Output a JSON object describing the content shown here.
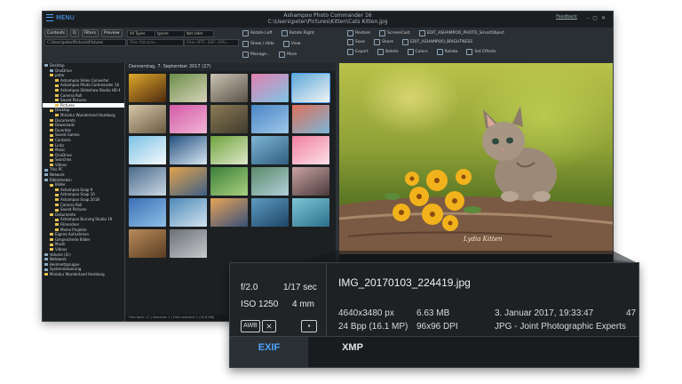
{
  "app": {
    "title": "Ashampoo Photo Commander 16",
    "path": "C:\\Users\\peter\\Pictures\\Kitten\\Cats Kitten.jpg",
    "menu_label": "MENU",
    "feedback_label": "Feedback"
  },
  "nav": {
    "buttons": [
      "Contexts",
      "Q",
      "Filters",
      "Preview"
    ],
    "path_value": "C:\\Users\\peter\\Pictures\\Pictures"
  },
  "toolbar": {
    "filter_type": "All Types",
    "filter_fav": "Ignore Favourites",
    "filter_rating": "Not older than...",
    "filter_name_placeholder": "Filter filename...",
    "filter_exif_placeholder": "Filter (IPTC, EXIF, GPS)...",
    "left_buttons": [
      "Rotate Left",
      "Rotate Right",
      "Show / Hide",
      "View",
      "Manage...",
      "More"
    ],
    "right_row1": [
      "Restore",
      "ScreenCast",
      "EDIT_ASHAMPOO_PHOTO_SmartObject"
    ],
    "right_row2": [
      "Save",
      "Share",
      "EDIT_ASHAMPOO_BRIGHTNESS"
    ],
    "right_row3": [
      "Export",
      "Delete",
      "Colors",
      "Rotate",
      "Set Effects"
    ]
  },
  "tree": [
    {
      "label": "Desktop",
      "depth": 0,
      "icon": "drive"
    },
    {
      "label": "OneDrive",
      "depth": 1,
      "icon": "drive"
    },
    {
      "label": "peter",
      "depth": 1,
      "icon": "folder"
    },
    {
      "label": "Ashampoo Video Converter",
      "depth": 2,
      "icon": "folder"
    },
    {
      "label": "Ashampoo Photo Commander 16",
      "depth": 2,
      "icon": "folder"
    },
    {
      "label": "Ashampoo Slideshow Studio HD 4",
      "depth": 2,
      "icon": "folder"
    },
    {
      "label": "Camera Roll",
      "depth": 2,
      "icon": "folder"
    },
    {
      "label": "Saved Pictures",
      "depth": 2,
      "icon": "folder"
    },
    {
      "label": "Pictures",
      "depth": 2,
      "icon": "folder",
      "selected": true
    },
    {
      "label": "Desktop",
      "depth": 1,
      "icon": "folder"
    },
    {
      "label": "Miniatur Wunderland Hamburg",
      "depth": 2,
      "icon": "folder"
    },
    {
      "label": "Documents",
      "depth": 1,
      "icon": "folder"
    },
    {
      "label": "Downloads",
      "depth": 1,
      "icon": "folder"
    },
    {
      "label": "Favorites",
      "depth": 1,
      "icon": "folder"
    },
    {
      "label": "Saved Games",
      "depth": 1,
      "icon": "folder"
    },
    {
      "label": "Contacts",
      "depth": 1,
      "icon": "folder"
    },
    {
      "label": "Links",
      "depth": 1,
      "icon": "folder"
    },
    {
      "label": "Music",
      "depth": 1,
      "icon": "folder"
    },
    {
      "label": "OneDrive",
      "depth": 1,
      "icon": "folder"
    },
    {
      "label": "Searches",
      "depth": 1,
      "icon": "folder"
    },
    {
      "label": "Videos",
      "depth": 1,
      "icon": "folder"
    },
    {
      "label": "This PC",
      "depth": 0,
      "icon": "drive"
    },
    {
      "label": "Network",
      "depth": 0,
      "icon": "drive"
    },
    {
      "label": "Bibliotheken",
      "depth": 0,
      "icon": "drive"
    },
    {
      "label": "Bilder",
      "depth": 1,
      "icon": "folder"
    },
    {
      "label": "Ashampoo Snap 9",
      "depth": 2,
      "icon": "folder"
    },
    {
      "label": "Ashampoo Snap 10",
      "depth": 2,
      "icon": "folder"
    },
    {
      "label": "Ashampoo Snap 2018",
      "depth": 2,
      "icon": "folder"
    },
    {
      "label": "Camera Roll",
      "depth": 2,
      "icon": "folder"
    },
    {
      "label": "Saved Pictures",
      "depth": 2,
      "icon": "folder"
    },
    {
      "label": "Dokumente",
      "depth": 1,
      "icon": "folder"
    },
    {
      "label": "Ashampoo Burning Studio 19",
      "depth": 2,
      "icon": "folder"
    },
    {
      "label": "Filmordner",
      "depth": 2,
      "icon": "folder"
    },
    {
      "label": "Meine Projekte",
      "depth": 2,
      "icon": "folder"
    },
    {
      "label": "Eigene Aufnahmen",
      "depth": 1,
      "icon": "folder"
    },
    {
      "label": "Gespeicherte Bilder",
      "depth": 1,
      "icon": "folder"
    },
    {
      "label": "Musik",
      "depth": 1,
      "icon": "folder"
    },
    {
      "label": "Videos",
      "depth": 1,
      "icon": "folder"
    },
    {
      "label": "Volume (D:)",
      "depth": 0,
      "icon": "drive"
    },
    {
      "label": "Netzwerk",
      "depth": 0,
      "icon": "drive"
    },
    {
      "label": "Heimnetzgruppe",
      "depth": 0,
      "icon": "drive"
    },
    {
      "label": "Systemsteuerung",
      "depth": 0,
      "icon": "drive"
    },
    {
      "label": "Miniatur Wunderland Hamburg",
      "depth": 0,
      "icon": "folder"
    }
  ],
  "grid": {
    "header": "Donnerstag, 7. September 2017 (27)",
    "status": "Files total: 27 | Selected: 1 | Files selected: 1 (22.6 MB)",
    "thumbs": [
      {
        "c1": "#e0a82a",
        "c2": "#4d2a10"
      },
      {
        "c1": "#6b8f4a",
        "c2": "#d7d2b8"
      },
      {
        "c1": "#c9c3b4",
        "c2": "#5b5247"
      },
      {
        "c1": "#e27fae",
        "c2": "#7fc6e8"
      },
      {
        "c1": "#5ea8d8",
        "c2": "#f2f4f6",
        "selected": true
      },
      {
        "c1": "#d6c7a9",
        "c2": "#6b5a42"
      },
      {
        "c1": "#d35aa7",
        "c2": "#f2b5d6"
      },
      {
        "c1": "#8c7b55",
        "c2": "#3f3a2c"
      },
      {
        "c1": "#4a86c7",
        "c2": "#9fc7e8"
      },
      {
        "c1": "#e06f5a",
        "c2": "#7ab6d9"
      },
      {
        "c1": "#7cc2e6",
        "c2": "#f5f9fb"
      },
      {
        "c1": "#25507e",
        "c2": "#d7e6f2"
      },
      {
        "c1": "#6fa33d",
        "c2": "#dfe8c9"
      },
      {
        "c1": "#7fb5d6",
        "c2": "#2f5e80"
      },
      {
        "c1": "#f07fa2",
        "c2": "#fde0e8"
      },
      {
        "c1": "#4b6a8a",
        "c2": "#c9d8e5"
      },
      {
        "c1": "#e3a34b",
        "c2": "#3e5f86"
      },
      {
        "c1": "#3b7f3a",
        "c2": "#a9cf7d"
      },
      {
        "c1": "#5a8a6a",
        "c2": "#b2cfd9"
      },
      {
        "c1": "#c9a3a3",
        "c2": "#4b3a3a"
      },
      {
        "c1": "#3a6fb5",
        "c2": "#8fc0e6"
      },
      {
        "c1": "#4d89b7",
        "c2": "#d2e3ef"
      },
      {
        "c1": "#e7a458",
        "c2": "#3a4f78"
      },
      {
        "c1": "#5e9bc1",
        "c2": "#1d4567"
      },
      {
        "c1": "#7ec5d7",
        "c2": "#2d6f8a"
      },
      {
        "c1": "#b88c5a",
        "c2": "#5a3c22"
      },
      {
        "c1": "#6a6f74",
        "c2": "#c6cacd"
      }
    ]
  },
  "preview": {
    "signature": "Lydia Kitten"
  },
  "info": {
    "aperture": "f/2.0",
    "shutter": "1/17 sec",
    "iso": "ISO 1250",
    "focal": "4 mm",
    "awb": "AWB",
    "filename": "IMG_20170103_224419.jpg",
    "dimensions": "4640x3480 px",
    "filesize": "6.63 MB",
    "date": "3. Januar 2017, 19:33:47",
    "extra": "47",
    "bpp": "24 Bpp (16.1 MP)",
    "dpi": "96x96 DPI",
    "format": "JPG - Joint Photographic Experts",
    "tab_exif": "EXIF",
    "tab_xmp": "XMP"
  },
  "colors": {
    "accent": "#4da3ff",
    "panel_dark": "#1d2124",
    "window_bg": "#1f2326"
  }
}
